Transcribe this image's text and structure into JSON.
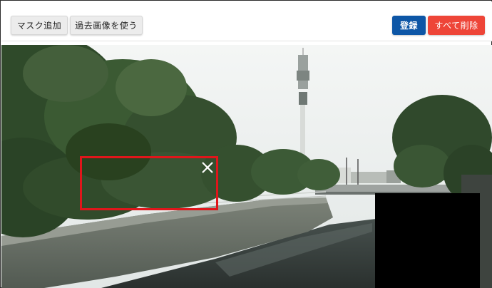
{
  "toolbar": {
    "add_mask_label": "マスク追加",
    "use_past_image_label": "過去画像を使う",
    "register_label": "登録",
    "delete_all_label": "すべて削除"
  },
  "colors": {
    "register_button": "#0d56a6",
    "delete_button": "#ee4538",
    "mask_border": "#e0161b"
  },
  "icons": {
    "mask_close": "close-icon"
  }
}
